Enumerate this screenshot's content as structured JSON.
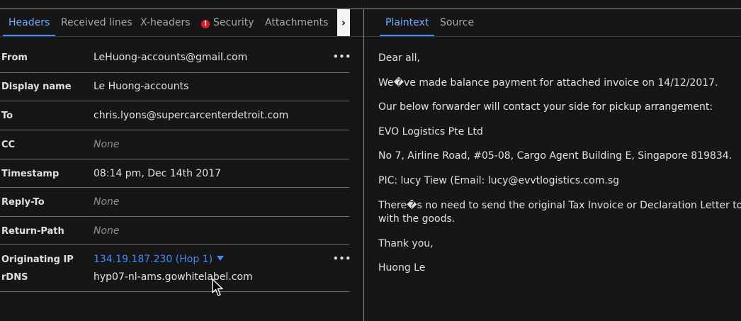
{
  "left_tabs": [
    {
      "label": "Headers"
    },
    {
      "label": "Received lines"
    },
    {
      "label": "X-headers"
    },
    {
      "label": "Security"
    },
    {
      "label": "Attachments"
    }
  ],
  "right_tabs": [
    {
      "label": "Plaintext"
    },
    {
      "label": "Source"
    }
  ],
  "headers": {
    "from": {
      "label": "From",
      "value": "LeHuong-accounts@gmail.com"
    },
    "display_name": {
      "label": "Display name",
      "value": "Le Huong-accounts"
    },
    "to": {
      "label": "To",
      "value": "chris.lyons@supercarcenterdetroit.com"
    },
    "cc": {
      "label": "CC",
      "value": "None"
    },
    "timestamp": {
      "label": "Timestamp",
      "value": "08:14 pm, Dec 14th 2017"
    },
    "reply_to": {
      "label": "Reply-To",
      "value": "None"
    },
    "return_path": {
      "label": "Return-Path",
      "value": "None"
    },
    "originating_ip": {
      "label": "Originating IP",
      "value": "134.19.187.230  (Hop 1)"
    },
    "rdns": {
      "label": "rDNS",
      "value": "hyp07-nl-ams.gowhitelabel.com"
    }
  },
  "message": {
    "lines": [
      "Dear all,",
      "We�ve made balance payment for attached invoice on 14/12/2017.",
      "Our below forwarder will contact your side for pickup arrangement:",
      "EVO Logistics Pte Ltd",
      "No 7, Airline Road, #05-08, Cargo Agent Building E, Singapore 819834.",
      "PIC: lucy Tiew (Email: lucy@evvtlogistics.com.sg",
      "There�s no need to send the original Tax Invoice or Declaration Letter together",
      "with the goods.",
      "Thank you,",
      "Huong Le"
    ]
  }
}
